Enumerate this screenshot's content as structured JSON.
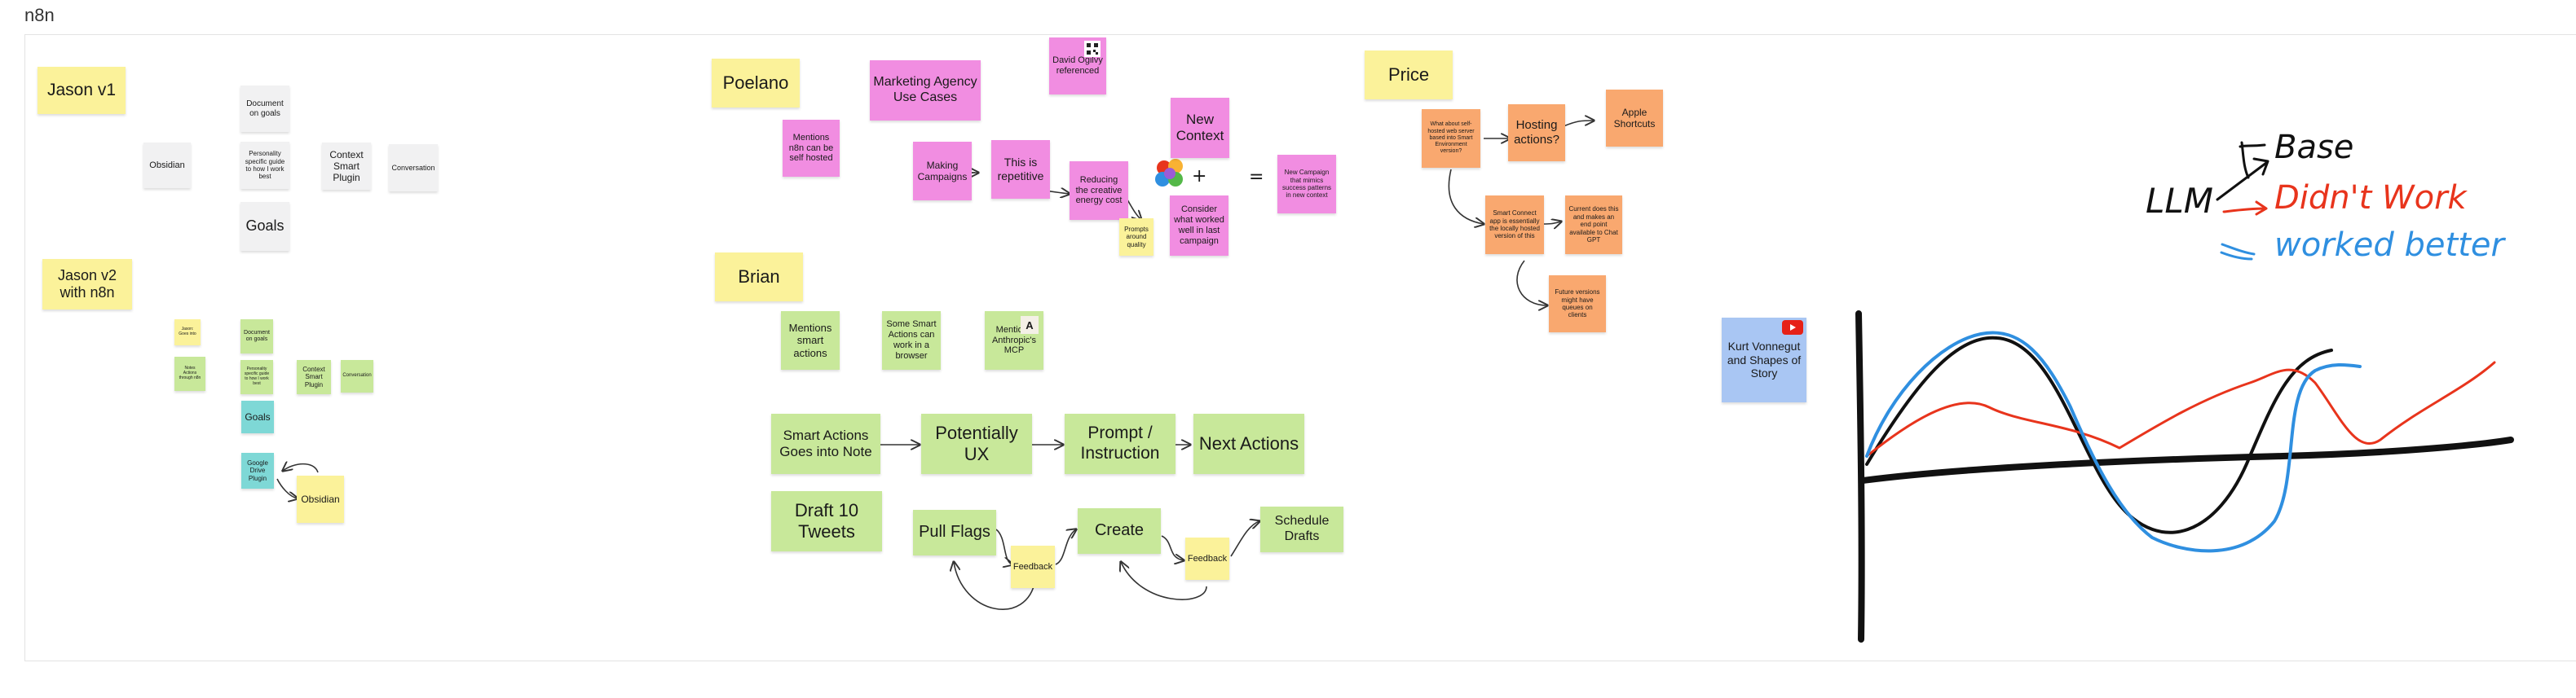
{
  "board": {
    "title": "n8n"
  },
  "jason_v1": {
    "title": "Jason v1",
    "obsidian": "Obsidian",
    "document_on_goals": "Document on goals",
    "personality_guide": "Personality specific guide to how I work best",
    "context_smart_plugin": "Context Smart Plugin",
    "conversation": "Conversation",
    "goals": "Goals"
  },
  "jason_v2": {
    "title": "Jason v2 with n8n",
    "small_yellow": "Jason: Goes into",
    "small_green": "Notes Actions through n8n",
    "document_on_goals": "Document on goals",
    "personality_guide": "Personality specific guide to how I work best",
    "context_smart_plugin": "Context Smart Plugin",
    "conversation": "Conversation",
    "goals": "Goals",
    "google_drive_plugin": "Google Drive Plugin",
    "obsidian": "Obsidian"
  },
  "poelano": {
    "title": "Poelano",
    "self_hosted": "Mentions n8n can be self hosted",
    "marketing_agency": "Marketing Agency Use Cases",
    "david_ogilvy": "David Ogilvy referenced",
    "making_campaigns": "Making Campaigns",
    "this_is_repetitive": "This is repetitive",
    "reducing_creative": "Reducing the creative energy cost",
    "prompts_quality": "Prompts around quality",
    "new_context": "New Context",
    "consider_what_worked": "Consider what worked well in last campaign",
    "plus": "+",
    "equals": "=",
    "new_campaign": "New Campaign that mimics success patterns in new context"
  },
  "brian": {
    "title": "Brian",
    "mentions_smart_actions": "Mentions smart actions",
    "some_smart_actions": "Some Smart Actions can work in a browser",
    "mentions_anthropic_mcp": "Mentions Anthropic's MCP",
    "smart_actions_note": "Smart Actions Goes into Note",
    "potentially_ux": "Potentially UX",
    "prompt_instruction": "Prompt / Instruction",
    "next_actions": "Next Actions",
    "draft_tweets": "Draft 10 Tweets",
    "pull_flags": "Pull Flags",
    "feedback_1": "Feedback",
    "create": "Create",
    "feedback_2": "Feedback",
    "schedule_drafts": "Schedule Drafts"
  },
  "price": {
    "title": "Price",
    "self_hosted_server": "What about self-hosted web server based into Smart Environment version?",
    "hosting_actions": "Hosting actions?",
    "apple_shortcuts": "Apple Shortcuts",
    "smart_connect": "Smart Connect app is essentially the locally hosted version of this",
    "current_does": "Current does this and makes an end point available to Chat GPT",
    "future_versions": "Future versions might have queues on clients"
  },
  "kurt": {
    "label": "Kurt Vonnegut and Shapes of Story"
  },
  "handwriting": {
    "llm": "LLM",
    "base": "Base",
    "didnt_work": "Didn't Work",
    "worked_better": "worked better"
  },
  "colors": {
    "yellow": "#fbf29a",
    "pink": "#f18de1",
    "green": "#c8e89a",
    "orange": "#f9a86f",
    "gray": "#f1f1f2",
    "teal": "#7ed8d6",
    "blue_note": "#a9c6f3",
    "ink_black": "#111111",
    "ink_red": "#e8341c",
    "ink_blue": "#2f8fe0"
  },
  "icons": [
    "brain-icon",
    "youtube-icon",
    "anthropic-logo-icon",
    "qr-icon"
  ]
}
